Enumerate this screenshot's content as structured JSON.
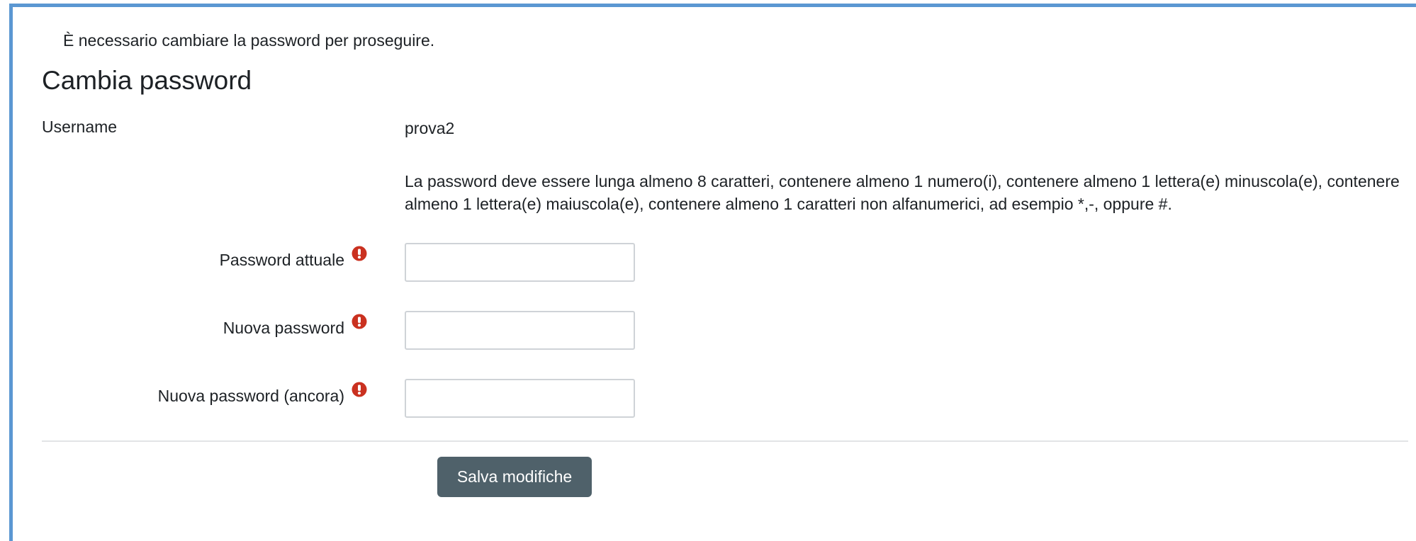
{
  "notice": "È necessario cambiare la password per proseguire.",
  "title": "Cambia password",
  "username": {
    "label": "Username",
    "value": "prova2"
  },
  "policy": "La password deve essere lunga almeno 8 caratteri, contenere almeno 1 numero(i), contenere almeno 1 lettera(e) minuscola(e), contenere almeno 1 lettera(e) maiuscola(e), contenere almeno 1 caratteri non alfanumerici, ad esempio *,-, oppure #.",
  "fields": {
    "current_password": {
      "label": "Password attuale",
      "value": "",
      "required_icon": "exclamation-circle-icon"
    },
    "new_password": {
      "label": "Nuova password",
      "value": "",
      "required_icon": "exclamation-circle-icon"
    },
    "new_password_again": {
      "label": "Nuova password (ancora)",
      "value": "",
      "required_icon": "exclamation-circle-icon"
    }
  },
  "save_button": {
    "label": "Salva modifiche"
  },
  "colors": {
    "frame_border": "#5b97d2",
    "required_icon": "#ca3120",
    "button_bg": "#4f616a",
    "button_text": "#ffffff"
  }
}
